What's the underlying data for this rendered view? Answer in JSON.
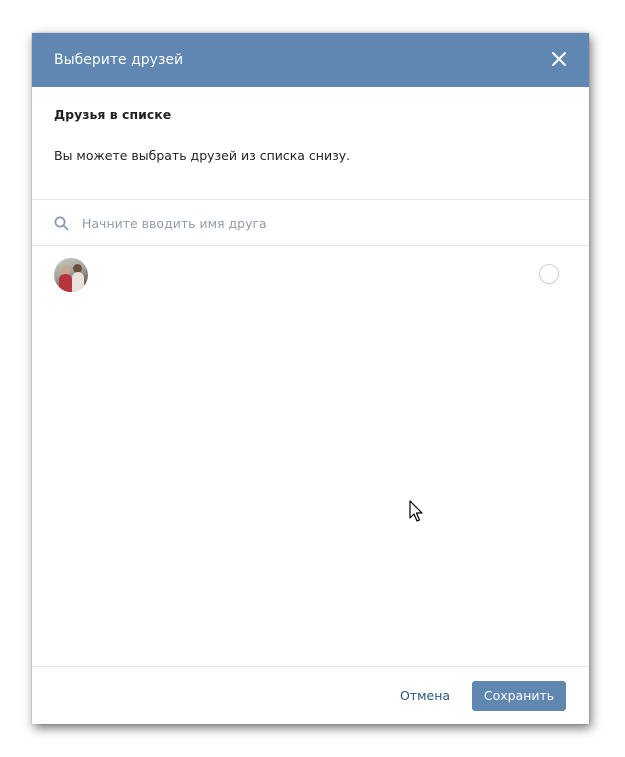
{
  "dialog": {
    "title": "Выберите друзей",
    "close_icon": "close-icon"
  },
  "list_section": {
    "title": "Друзья в списке",
    "description": "Вы можете выбрать друзей из списка снизу."
  },
  "search": {
    "placeholder": "Начните вводить имя друга",
    "value": "",
    "icon": "search-icon"
  },
  "friends": [
    {
      "name": "",
      "selected": false,
      "avatar_icon": "avatar"
    }
  ],
  "footer": {
    "cancel_label": "Отмена",
    "save_label": "Сохранить"
  },
  "colors": {
    "header_bg": "#5f87b1",
    "primary_button": "#5f87b1",
    "link": "#2a5885",
    "text": "#222222",
    "placeholder": "#939ba6",
    "divider": "#e7e8ec"
  }
}
